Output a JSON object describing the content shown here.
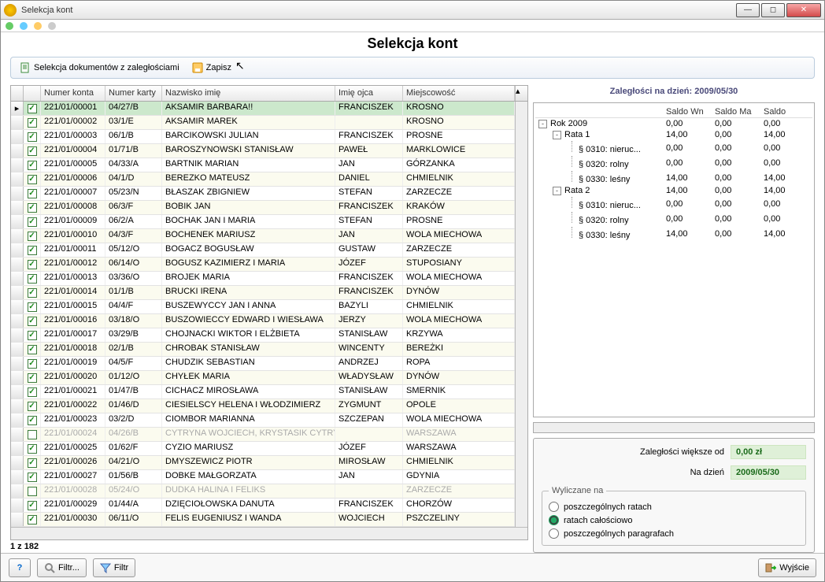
{
  "window": {
    "title": "Selekcja kont"
  },
  "header": {
    "main_title": "Selekcja kont"
  },
  "toolbar": {
    "sel_docs_label": "Selekcja dokumentów z zaległościami",
    "save_label": "Zapisz"
  },
  "grid": {
    "columns": {
      "numer_konta": "Numer konta",
      "numer_karty": "Numer karty",
      "nazwisko": "Nazwisko imię",
      "imie_ojca": "Imię ojca",
      "miejscowosc": "Miejscowość"
    },
    "rows": [
      {
        "chk": true,
        "sel": true,
        "nr": "221/01/00001",
        "karta": "04/27/B",
        "nazw": "AKSAMIR BARBARA!!",
        "ojca": "FRANCISZEK",
        "miej": "KROSNO"
      },
      {
        "chk": true,
        "nr": "221/01/00002",
        "karta": "03/1/E",
        "nazw": "AKSAMIR MAREK",
        "ojca": "",
        "miej": "KROSNO"
      },
      {
        "chk": true,
        "nr": "221/01/00003",
        "karta": "06/1/B",
        "nazw": "BARCIKOWSKI JULIAN",
        "ojca": "FRANCISZEK",
        "miej": "PROSNE"
      },
      {
        "chk": true,
        "nr": "221/01/00004",
        "karta": "01/71/B",
        "nazw": "BAROSZYNOWSKI STANISŁAW",
        "ojca": "PAWEŁ",
        "miej": "MARKLOWICE"
      },
      {
        "chk": true,
        "nr": "221/01/00005",
        "karta": "04/33/A",
        "nazw": "BARTNIK MARIAN",
        "ojca": "JAN",
        "miej": "GÓRZANKA"
      },
      {
        "chk": true,
        "nr": "221/01/00006",
        "karta": "04/1/D",
        "nazw": "BEREZKO MATEUSZ",
        "ojca": "DANIEL",
        "miej": "CHMIELNIK"
      },
      {
        "chk": true,
        "nr": "221/01/00007",
        "karta": "05/23/N",
        "nazw": "BŁASZAK ZBIGNIEW",
        "ojca": "STEFAN",
        "miej": "ZARZECZE"
      },
      {
        "chk": true,
        "nr": "221/01/00008",
        "karta": "06/3/F",
        "nazw": "BOBIK JAN",
        "ojca": "FRANCISZEK",
        "miej": "KRAKÓW"
      },
      {
        "chk": true,
        "nr": "221/01/00009",
        "karta": "06/2/A",
        "nazw": "BOCHAK JAN I MARIA",
        "ojca": "STEFAN",
        "miej": "PROSNE"
      },
      {
        "chk": true,
        "nr": "221/01/00010",
        "karta": "04/3/F",
        "nazw": "BOCHENEK MARIUSZ",
        "ojca": "JAN",
        "miej": "WOLA MIECHOWA"
      },
      {
        "chk": true,
        "nr": "221/01/00011",
        "karta": "05/12/O",
        "nazw": "BOGACZ BOGUSŁAW",
        "ojca": "GUSTAW",
        "miej": "ZARZECZE"
      },
      {
        "chk": true,
        "nr": "221/01/00012",
        "karta": "06/14/O",
        "nazw": "BOGUSZ KAZIMIERZ I MARIA",
        "ojca": "JÓZEF",
        "miej": "STUPOSIANY"
      },
      {
        "chk": true,
        "nr": "221/01/00013",
        "karta": "03/36/O",
        "nazw": "BROJEK MARIA",
        "ojca": "FRANCISZEK",
        "miej": "WOLA MIECHOWA"
      },
      {
        "chk": true,
        "nr": "221/01/00014",
        "karta": "01/1/B",
        "nazw": "BRUCKI IRENA",
        "ojca": "FRANCISZEK",
        "miej": "DYNÓW"
      },
      {
        "chk": true,
        "nr": "221/01/00015",
        "karta": "04/4/F",
        "nazw": "BUSZEWYCCY JAN I ANNA",
        "ojca": "BAZYLI",
        "miej": "CHMIELNIK"
      },
      {
        "chk": true,
        "nr": "221/01/00016",
        "karta": "03/18/O",
        "nazw": "BUSZOWIECCY EDWARD I WIESŁAWA",
        "ojca": "JERZY",
        "miej": "WOLA MIECHOWA"
      },
      {
        "chk": true,
        "nr": "221/01/00017",
        "karta": "03/29/B",
        "nazw": "CHOJNACKI WIKTOR I ELŻBIETA",
        "ojca": "STANISŁAW",
        "miej": "KRZYWA"
      },
      {
        "chk": true,
        "nr": "221/01/00018",
        "karta": "02/1/B",
        "nazw": "CHROBAK STANISŁAW",
        "ojca": "WINCENTY",
        "miej": "BEREŻKI"
      },
      {
        "chk": true,
        "nr": "221/01/00019",
        "karta": "04/5/F",
        "nazw": "CHUDZIK SEBASTIAN",
        "ojca": "ANDRZEJ",
        "miej": "ROPA"
      },
      {
        "chk": true,
        "nr": "221/01/00020",
        "karta": "01/12/O",
        "nazw": "CHYŁEK MARIA",
        "ojca": "WŁADYSŁAW",
        "miej": "DYNÓW"
      },
      {
        "chk": true,
        "nr": "221/01/00021",
        "karta": "01/47/B",
        "nazw": "CICHACZ MIROSŁAWA",
        "ojca": "STANISŁAW",
        "miej": "SMERNIK"
      },
      {
        "chk": true,
        "nr": "221/01/00022",
        "karta": "01/46/D",
        "nazw": "CIESIELSCY HELENA I WŁODZIMIERZ",
        "ojca": "ZYGMUNT",
        "miej": "OPOLE"
      },
      {
        "chk": true,
        "nr": "221/01/00023",
        "karta": "03/2/D",
        "nazw": "CIOMBOR MARIANNA",
        "ojca": "SZCZEPAN",
        "miej": "WOLA MIECHOWA"
      },
      {
        "chk": false,
        "disabled": true,
        "nr": "221/01/00024",
        "karta": "04/26/B",
        "nazw": "CYTRYNA WOJCIECH, KRYSTASIK CYTRYNA BOGDAN",
        "ojca": "",
        "miej": "WARSZAWA"
      },
      {
        "chk": true,
        "nr": "221/01/00025",
        "karta": "01/62/F",
        "nazw": "CYZIO MARIUSZ",
        "ojca": "JÓZEF",
        "miej": "WARSZAWA"
      },
      {
        "chk": true,
        "nr": "221/01/00026",
        "karta": "04/21/O",
        "nazw": "DMYSZEWICZ PIOTR",
        "ojca": "MIROSŁAW",
        "miej": "CHMIELNIK"
      },
      {
        "chk": true,
        "nr": "221/01/00027",
        "karta": "01/56/B",
        "nazw": "DOBKE MAŁGORZATA",
        "ojca": "JAN",
        "miej": "GDYNIA"
      },
      {
        "chk": false,
        "disabled": true,
        "nr": "221/01/00028",
        "karta": "05/24/O",
        "nazw": "DUDKA HALINA I FELIKS",
        "ojca": "",
        "miej": "ZARZECZE"
      },
      {
        "chk": true,
        "nr": "221/01/00029",
        "karta": "01/44/A",
        "nazw": "DZIĘCIOŁOWSKA DANUTA",
        "ojca": "FRANCISZEK",
        "miej": "CHORZÓW"
      },
      {
        "chk": true,
        "nr": "221/01/00030",
        "karta": "06/11/O",
        "nazw": "FELIS EUGENIUSZ I WANDA",
        "ojca": "WOJCIECH",
        "miej": "PSZCZELINY"
      }
    ],
    "row_count_label": "1 z 182"
  },
  "right": {
    "header_prefix": "Zaległości na dzień: ",
    "header_date": "2009/05/30",
    "col_wn": "Saldo Wn",
    "col_ma": "Saldo Ma",
    "col_saldo": "Saldo",
    "tree": [
      {
        "lvl": 0,
        "tog": "-",
        "lbl": "Rok 2009",
        "wn": "0,00",
        "ma": "0,00",
        "s": "0,00"
      },
      {
        "lvl": 1,
        "tog": "-",
        "lbl": "Rata 1",
        "wn": "14,00",
        "ma": "0,00",
        "s": "14,00"
      },
      {
        "lvl": 2,
        "lbl": "§ 0310: nieruc...",
        "wn": "0,00",
        "ma": "0,00",
        "s": "0,00"
      },
      {
        "lvl": 2,
        "lbl": "§ 0320: rolny",
        "wn": "0,00",
        "ma": "0,00",
        "s": "0,00"
      },
      {
        "lvl": 2,
        "lbl": "§ 0330: leśny",
        "wn": "14,00",
        "ma": "0,00",
        "s": "14,00"
      },
      {
        "lvl": 1,
        "tog": "-",
        "lbl": "Rata 2",
        "wn": "14,00",
        "ma": "0,00",
        "s": "14,00"
      },
      {
        "lvl": 2,
        "lbl": "§ 0310: nieruc...",
        "wn": "0,00",
        "ma": "0,00",
        "s": "0,00"
      },
      {
        "lvl": 2,
        "lbl": "§ 0320: rolny",
        "wn": "0,00",
        "ma": "0,00",
        "s": "0,00"
      },
      {
        "lvl": 2,
        "lbl": "§ 0330: leśny",
        "wn": "14,00",
        "ma": "0,00",
        "s": "14,00"
      }
    ],
    "filter": {
      "greater_label": "Zaległości większe od",
      "greater_value": "0,00 zł",
      "date_label": "Na dzień",
      "date_value": "2009/05/30",
      "group_label": "Wyliczane na",
      "opt1": "poszczególnych ratach",
      "opt2": "ratach całościowo",
      "opt3": "poszczególnych paragrafach"
    }
  },
  "footer": {
    "help": "?",
    "filtr_btn": "Filtr...",
    "filtr_btn2": "Filtr",
    "exit": "Wyjście"
  }
}
